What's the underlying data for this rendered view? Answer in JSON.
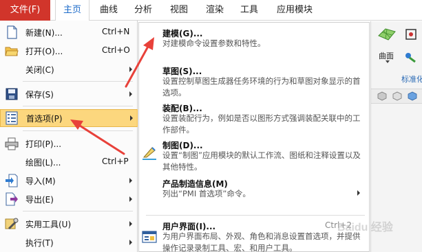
{
  "menubar": {
    "file_tab": "文件(F)",
    "tabs": [
      {
        "label": "主页",
        "active": true
      },
      {
        "label": "曲线",
        "active": false
      },
      {
        "label": "分析",
        "active": false
      },
      {
        "label": "视图",
        "active": false
      },
      {
        "label": "渲染",
        "active": false
      },
      {
        "label": "工具",
        "active": false
      },
      {
        "label": "应用模块",
        "active": false
      }
    ]
  },
  "ribbon": {
    "surface_label": "曲面",
    "group_label": "标准化"
  },
  "file_menu": {
    "items": [
      {
        "label": "新建(N)...",
        "shortcut": "Ctrl+N",
        "icon": "new-document-icon",
        "submenu": false
      },
      {
        "label": "打开(O)...",
        "shortcut": "Ctrl+O",
        "icon": "open-folder-icon",
        "submenu": false
      },
      {
        "label": "关闭(C)",
        "shortcut": "",
        "icon": "",
        "submenu": true
      },
      {
        "label": "保存(S)",
        "shortcut": "",
        "icon": "save-disk-icon",
        "submenu": true
      },
      {
        "label": "首选项(P)",
        "shortcut": "",
        "icon": "preferences-list-icon",
        "submenu": true,
        "selected": true
      },
      {
        "label": "打印(P)...",
        "shortcut": "",
        "icon": "printer-icon",
        "submenu": false
      },
      {
        "label": "绘图(L)...",
        "shortcut": "Ctrl+P",
        "icon": "",
        "submenu": false
      },
      {
        "label": "导入(M)",
        "shortcut": "",
        "icon": "import-icon",
        "submenu": true
      },
      {
        "label": "导出(E)",
        "shortcut": "",
        "icon": "export-icon",
        "submenu": true
      },
      {
        "label": "实用工具(U)",
        "shortcut": "",
        "icon": "utilities-icon",
        "submenu": true
      },
      {
        "label": "执行(T)",
        "shortcut": "",
        "icon": "",
        "submenu": true
      }
    ]
  },
  "preferences_menu": {
    "items": [
      {
        "title": "建模(G)...",
        "desc": "对建模命令设置参数和特性。"
      },
      {
        "title": "草图(S)...",
        "desc": "设置控制草图生成器任务环境的行为和草图对象显示的首选项。"
      },
      {
        "title": "装配(B)...",
        "desc": "设置装配行为，例如是否以图形方式强调装配关联中的工作部件。"
      },
      {
        "title": "制图(D)...",
        "desc": "设置“制图”应用模块的默认工作流、图纸和注释设置以及其他特性。"
      },
      {
        "title": "产品制造信息(M)",
        "desc": "列出“PMI 首选项”命令。"
      },
      {
        "title": "用户界面(I)...",
        "shortcut": "Ctrl+2",
        "desc": "为用户界面布局、外观、角色和消息设置首选项，并提供操作记录录制工具、宏、和用户工具。"
      }
    ]
  },
  "watermark": "Baidu 经验",
  "colors": {
    "file_tab": "#d1352b",
    "active_tab_text": "#1b6ac9",
    "selected_item": "#fcd77e",
    "annotation_arrow": "#e8413a"
  }
}
